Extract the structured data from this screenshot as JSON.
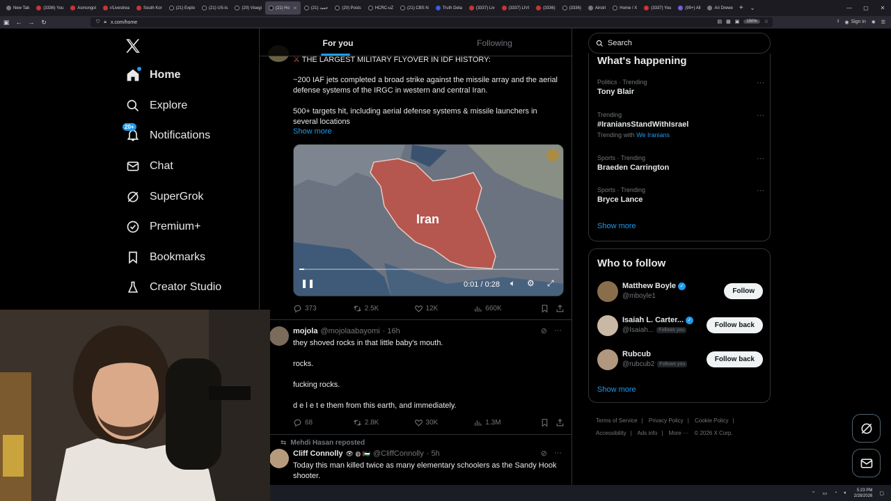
{
  "browser": {
    "tabs": [
      {
        "label": "New Tab",
        "fav": "g"
      },
      {
        "label": "(3336) You",
        "fav": "r"
      },
      {
        "label": "Asmongol",
        "fav": "r"
      },
      {
        "label": "r/Livestrea",
        "fav": "r"
      },
      {
        "label": "South Kor",
        "fav": "r"
      },
      {
        "label": "(21) Explo",
        "fav": "x"
      },
      {
        "label": "(21) US-Is",
        "fav": "x"
      },
      {
        "label": "(20) Visegi",
        "fav": "x"
      },
      {
        "label": "(21) Ho",
        "fav": "x",
        "active": true
      },
      {
        "label": "حمید (21)",
        "fav": "x"
      },
      {
        "label": "(20) Posts",
        "fav": "x"
      },
      {
        "label": "HCRC-uZ",
        "fav": "x"
      },
      {
        "label": "(21) CBS N",
        "fav": "x"
      },
      {
        "label": "Truth Deta",
        "fav": "b"
      },
      {
        "label": "(3337) Liv",
        "fav": "r"
      },
      {
        "label": "(3337) LIVI",
        "fav": "r"
      },
      {
        "label": "(3336)",
        "fav": "r"
      },
      {
        "label": "(3336)",
        "fav": "x"
      },
      {
        "label": "Airstri",
        "fav": "g"
      },
      {
        "label": "Home / X",
        "fav": "x"
      },
      {
        "label": "(3337) You",
        "fav": "r"
      },
      {
        "label": "(99+) All",
        "fav": "p"
      },
      {
        "label": "Ari Drewe",
        "fav": "g"
      }
    ],
    "url": "x.com/home",
    "zoom": "150%",
    "sign_in": "Sign in"
  },
  "sidebar": {
    "items": [
      {
        "label": "Home",
        "icon": "home-icon",
        "active": true
      },
      {
        "label": "Explore",
        "icon": "search-icon"
      },
      {
        "label": "Notifications",
        "icon": "bell-icon",
        "badge": "20+"
      },
      {
        "label": "Chat",
        "icon": "mail-icon"
      },
      {
        "label": "SuperGrok",
        "icon": "grok-icon"
      },
      {
        "label": "Premium+",
        "icon": "verified-icon"
      },
      {
        "label": "Bookmarks",
        "icon": "bookmark-icon"
      },
      {
        "label": "Creator Studio",
        "icon": "flask-icon"
      }
    ]
  },
  "feed": {
    "tabs": [
      "For you",
      "Following"
    ],
    "post1": {
      "line1": "THE LARGEST MILITARY FLYOVER IN IDF HISTORY:",
      "para1": "~200 IAF jets completed a broad strike against the missile array and the aerial defense systems of the IRGC in western and central Iran.",
      "para2": "500+ targets hit, including aerial defense systems & missile launchers in several locations",
      "show_more": "Show more",
      "video": {
        "label": "Iran",
        "time": "0:01 / 0:28",
        "progress": 0.02
      },
      "stats": {
        "replies": "373",
        "reposts": "2.5K",
        "likes": "12K",
        "views": "660K"
      }
    },
    "post2": {
      "name": "mojola",
      "handle": "@mojolaabayomi",
      "time": "· 16h",
      "lines": [
        "they shoved rocks in that little baby's mouth.",
        "rocks.",
        "fucking rocks.",
        "d e l e t e them from this earth, and immediately."
      ],
      "stats": {
        "replies": "68",
        "reposts": "2.8K",
        "likes": "30K",
        "views": "1.3M"
      }
    },
    "post3": {
      "reposted_by": "Mehdi Hasan reposted",
      "name": "Cliff Connolly",
      "handle": "@CliffConnolly",
      "time": "· 5h",
      "text": "Today this man killed twice as many elementary schoolers as the Sandy Hook shooter."
    }
  },
  "right": {
    "search_placeholder": "Search",
    "happening_title": "What's happening",
    "trends": [
      {
        "meta": "Politics · Trending",
        "name": "Tony Blair"
      },
      {
        "meta": "Trending",
        "name": "#IraniansStandWithIsrael",
        "with_label": "Trending with",
        "with_link": "We Iranians"
      },
      {
        "meta": "Sports · Trending",
        "name": "Braeden Carrington"
      },
      {
        "meta": "Sports · Trending",
        "name": "Bryce Lance"
      }
    ],
    "show_more": "Show more",
    "wtf_title": "Who to follow",
    "wtf": [
      {
        "name": "Matthew Boyle",
        "handle": "@mboyle1",
        "button": "Follow",
        "verified": true,
        "follows_you": ""
      },
      {
        "name": "Isaiah L. Carter...",
        "handle": "@Isaiah...",
        "button": "Follow back",
        "verified": true,
        "follows_you": "Follows you"
      },
      {
        "name": "Rubcub",
        "handle": "@rubcub2",
        "button": "Follow back",
        "verified": false,
        "follows_you": "Follows you"
      }
    ],
    "wtf_more": "Show more",
    "footer": [
      "Terms of Service",
      "|",
      "Privacy Policy",
      "|",
      "Cookie Policy",
      "|",
      "Accessibility",
      "|",
      "Ads info",
      "|",
      "More ···",
      "© 2026 X Corp."
    ]
  },
  "taskbar": {
    "time": "5:23 PM",
    "date": "2/28/2026"
  }
}
